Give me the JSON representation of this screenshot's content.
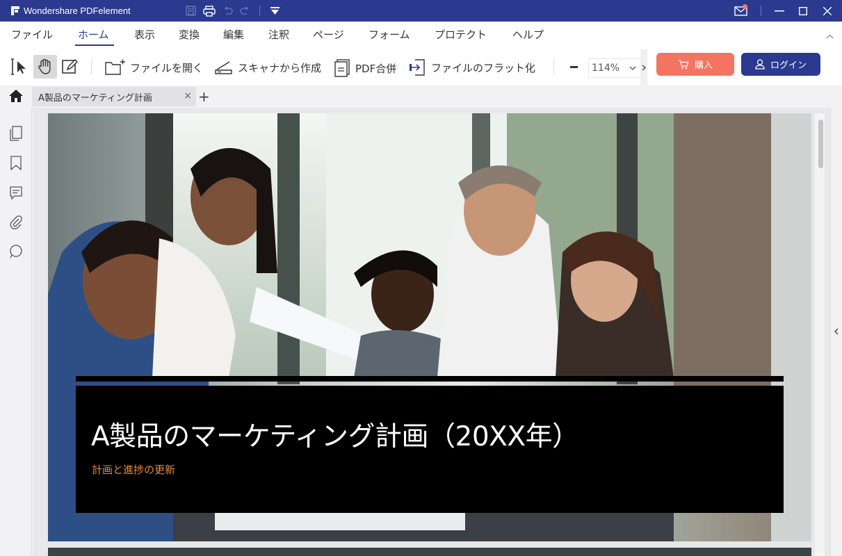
{
  "app": {
    "title": "Wondershare PDFelement"
  },
  "menu": {
    "items": [
      "ファイル",
      "ホーム",
      "表示",
      "変換",
      "編集",
      "注釈",
      "ページ",
      "フォーム",
      "プロテクト",
      "ヘルプ"
    ],
    "active": "ホーム"
  },
  "toolbar": {
    "open_file": "ファイルを開く",
    "scan_create": "スキャナから作成",
    "pdf_merge": "PDF合併",
    "flatten": "ファイルのフラット化",
    "zoom": "114%",
    "buy": "購入",
    "login": "ログイン"
  },
  "tabs": {
    "doc_tab": "A製品のマーケティング計画",
    "close": "×",
    "add": "+"
  },
  "document": {
    "title": "A製品のマーケティング計画（20XX年）",
    "subtitle": "計画と進捗の更新"
  },
  "colors": {
    "brand": "#2b3a8f",
    "buy": "#f37561",
    "subtitle": "#e48b3c"
  }
}
